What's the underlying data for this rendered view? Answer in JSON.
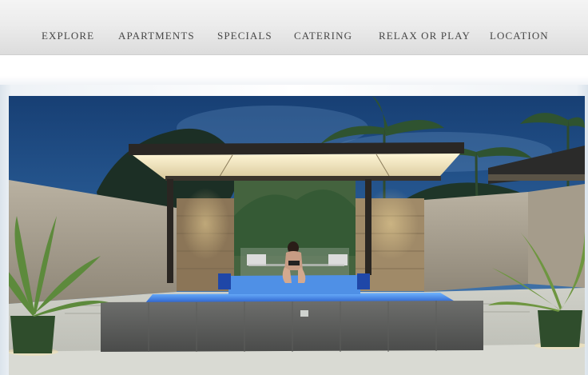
{
  "nav": {
    "items": [
      {
        "label": "EXPLORE"
      },
      {
        "label": "APARTMENTS"
      },
      {
        "label": "SPECIALS"
      },
      {
        "label": "CATERING"
      },
      {
        "label": "RELAX OR PLAY"
      },
      {
        "label": "LOCATION"
      }
    ]
  },
  "hero": {
    "image": "resort-pool-pavilion-photo"
  },
  "colors": {
    "nav_text": "#474747",
    "nav_background": "#ececec",
    "sky": "#1f4f86",
    "pool": "#2e6fd1"
  }
}
